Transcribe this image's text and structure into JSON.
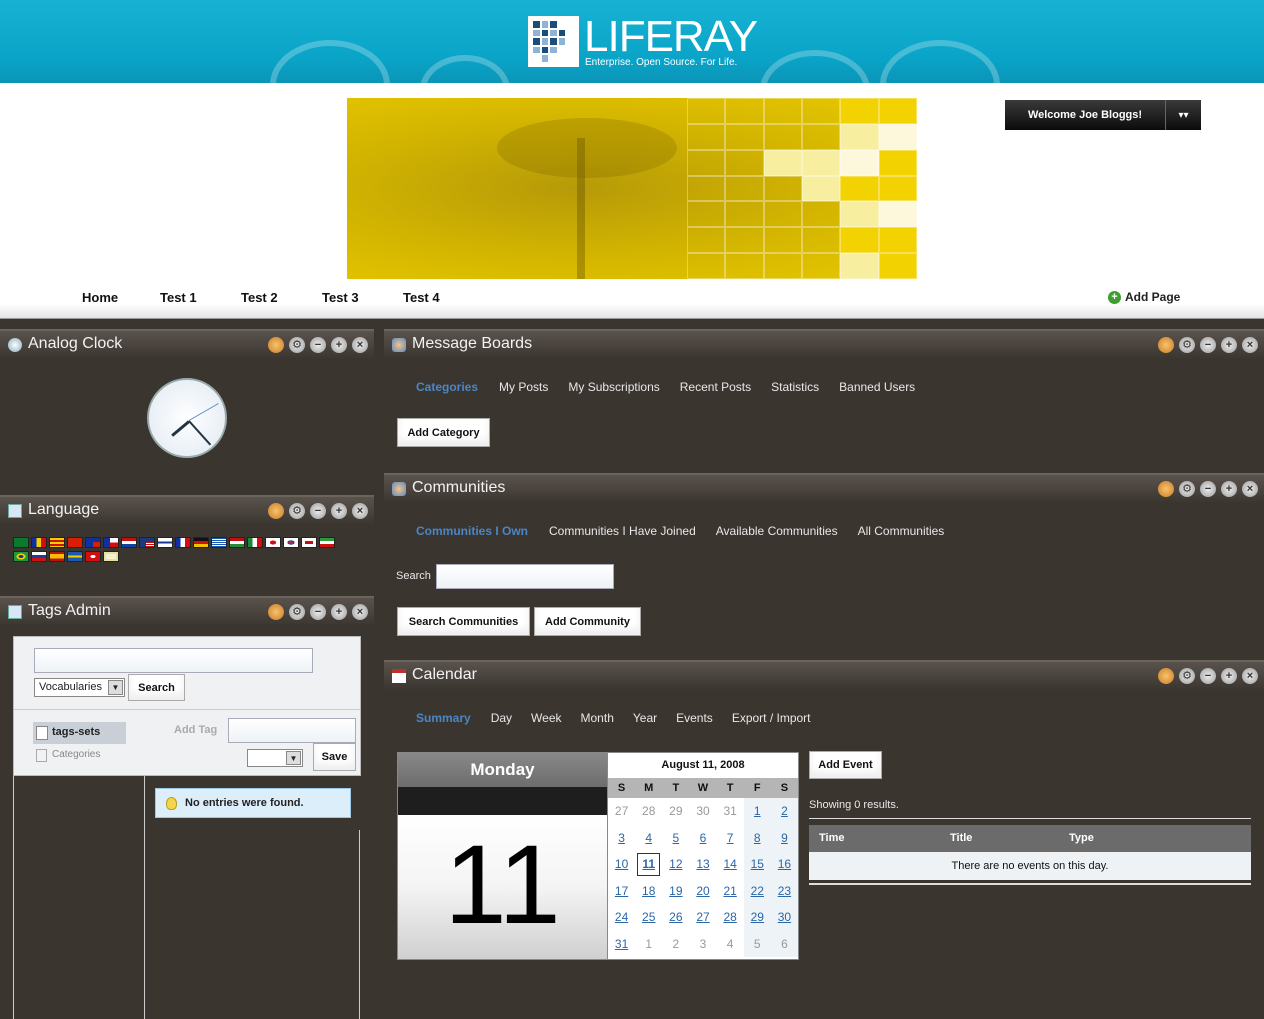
{
  "header": {
    "logo_text": "LIFERAY",
    "logo_tagline": "Enterprise. Open Source. For Life.",
    "welcome": "Welcome Joe Bloggs!"
  },
  "nav": {
    "items": [
      "Home",
      "Test 1",
      "Test 2",
      "Test 3",
      "Test 4"
    ],
    "add_page": "Add Page"
  },
  "portlets": {
    "analog_clock": {
      "title": "Analog Clock"
    },
    "language": {
      "title": "Language"
    },
    "tags_admin": {
      "title": "Tags Admin",
      "vocab_select": "Vocabularies",
      "search_button": "Search",
      "tags_sets": "tags-sets",
      "categories": "Categories",
      "add_tag_label": "Add Tag",
      "save_button": "Save",
      "no_entries": "No entries were found."
    },
    "message_boards": {
      "title": "Message Boards",
      "tabs": [
        "Categories",
        "My Posts",
        "My Subscriptions",
        "Recent Posts",
        "Statistics",
        "Banned Users"
      ],
      "add_category": "Add Category"
    },
    "communities": {
      "title": "Communities",
      "tabs": [
        "Communities I Own",
        "Communities I Have Joined",
        "Available Communities",
        "All Communities"
      ],
      "search_label": "Search",
      "search_button": "Search Communities",
      "add_button": "Add Community"
    },
    "calendar": {
      "title": "Calendar",
      "tabs": [
        "Summary",
        "Day",
        "Week",
        "Month",
        "Year",
        "Events",
        "Export / Import"
      ],
      "day_name": "Monday",
      "day_number": "11",
      "month_title": "August 11, 2008",
      "weekdays": [
        "S",
        "M",
        "T",
        "W",
        "T",
        "F",
        "S"
      ],
      "add_event": "Add Event",
      "showing": "Showing 0 results.",
      "columns": [
        "Time",
        "Title",
        "Type"
      ],
      "empty_row": "There are no events on this day."
    }
  },
  "icons": {
    "portlet_controls": [
      "palette-icon",
      "gear-icon",
      "minimize-icon",
      "maximize-icon",
      "close-icon"
    ]
  },
  "colors": {
    "header_bg": "#0aa4c8",
    "content_bg": "#3b3530",
    "selected_tab": "#4a86c5"
  }
}
